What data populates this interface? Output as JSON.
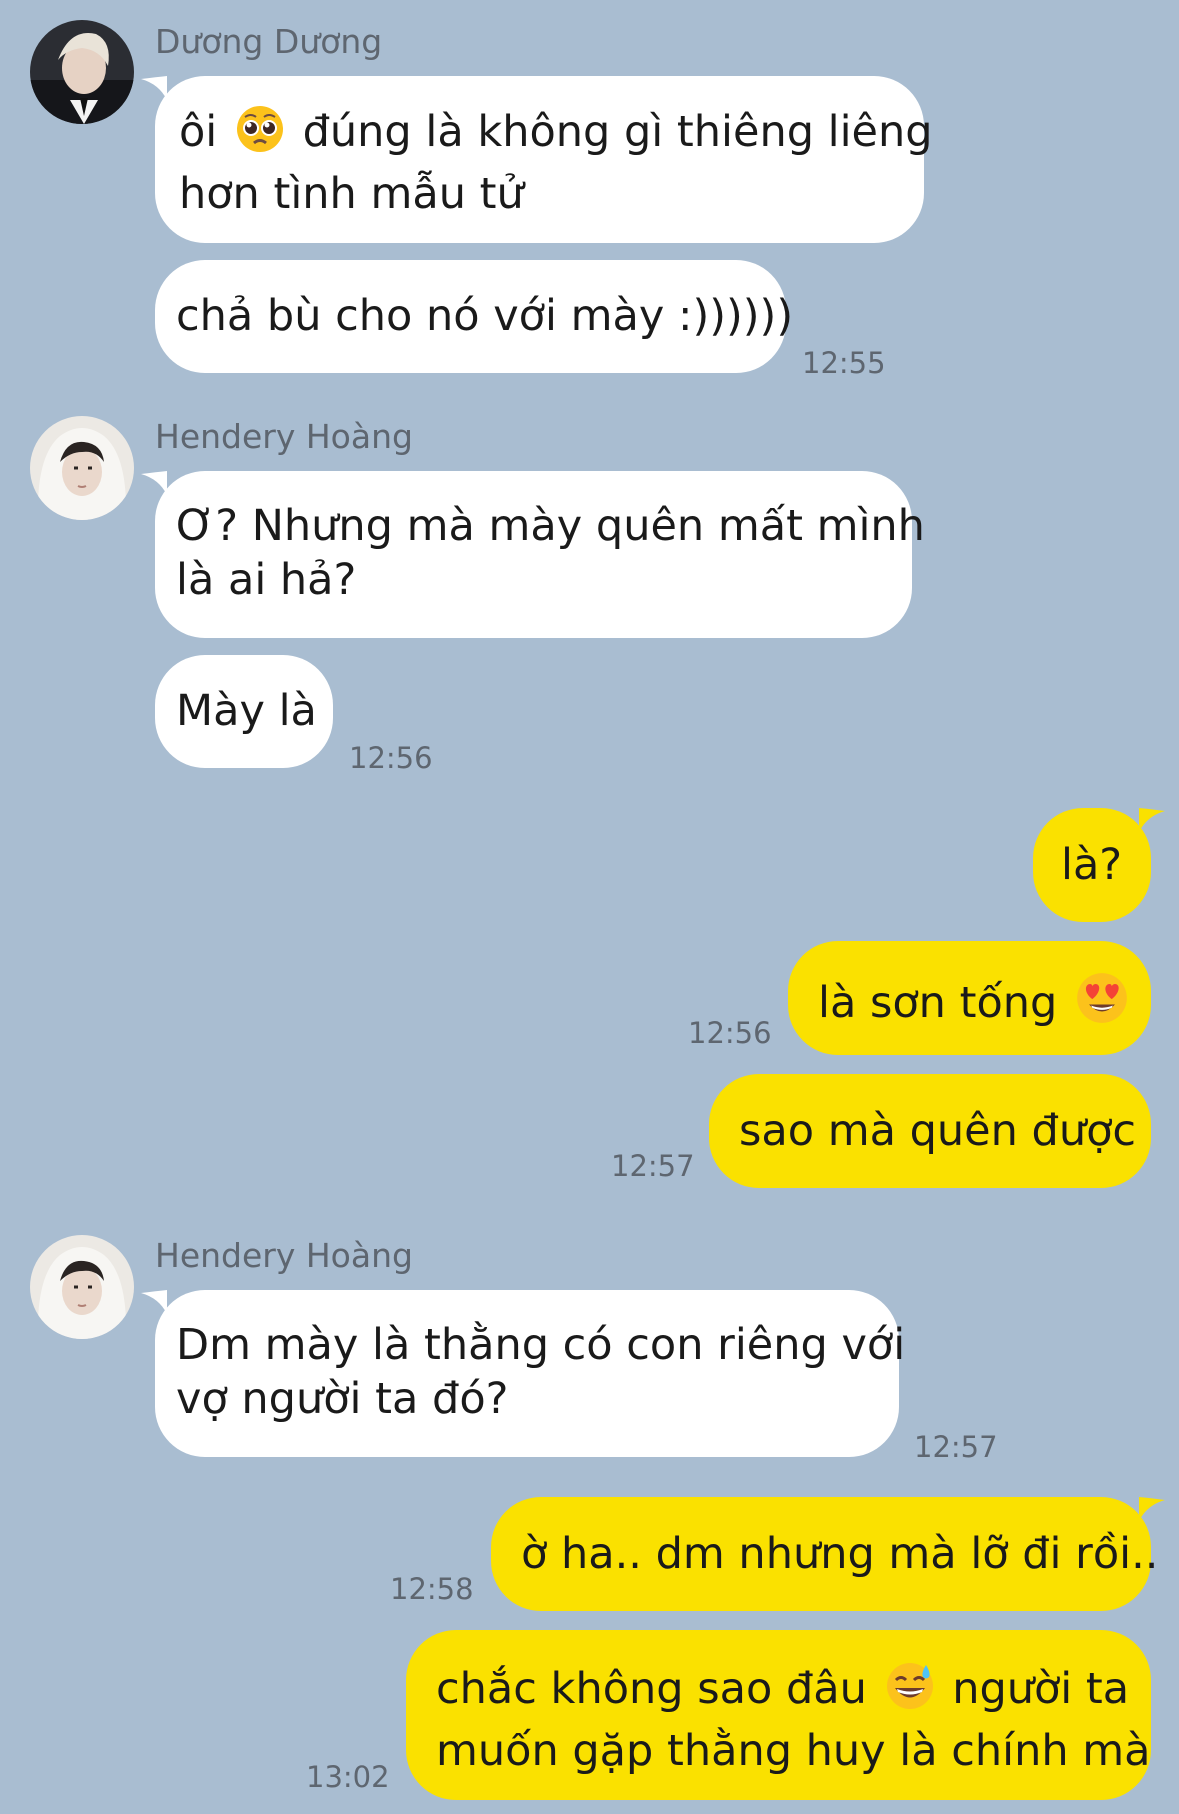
{
  "messages": [
    {
      "sender": "Dương Dương",
      "lines": [
        "ôi ",
        " đúng là không gì thiêng liêng",
        "hơn tình mẫu tử"
      ],
      "emoji_icon": "pleading-face-icon"
    },
    {
      "lines": [
        "chả bù cho nó với mày :))))))"
      ],
      "time": "12:55"
    },
    {
      "sender": "Hendery Hoàng",
      "lines": [
        "Ơ? Nhưng mà mày quên mất mình",
        "là ai hả?"
      ]
    },
    {
      "lines": [
        "Mày là"
      ],
      "time": "12:56"
    },
    {
      "lines": [
        "là?"
      ]
    },
    {
      "lines": [
        "là sơn tống "
      ],
      "time": "12:56",
      "emoji_icon": "heart-eyes-icon"
    },
    {
      "lines": [
        "sao mà quên được"
      ],
      "time": "12:57"
    },
    {
      "sender": "Hendery Hoàng",
      "lines": [
        "Dm mày là thằng có con riêng với",
        "vợ người ta đó?"
      ],
      "time": "12:57"
    },
    {
      "lines": [
        "ờ ha.. dm nhưng mà lỡ đi rồi.."
      ],
      "time": "12:58"
    },
    {
      "lines": [
        "chắc không sao đâu ",
        " người ta",
        "muốn gặp thằng huy là chính mà"
      ],
      "time": "13:02",
      "emoji_icon": "grinning-sweat-icon"
    }
  ],
  "colors": {
    "background": "#a9bdd1",
    "incoming_bubble": "#ffffff",
    "outgoing_bubble": "#fae100",
    "meta_text": "#5e6670"
  }
}
